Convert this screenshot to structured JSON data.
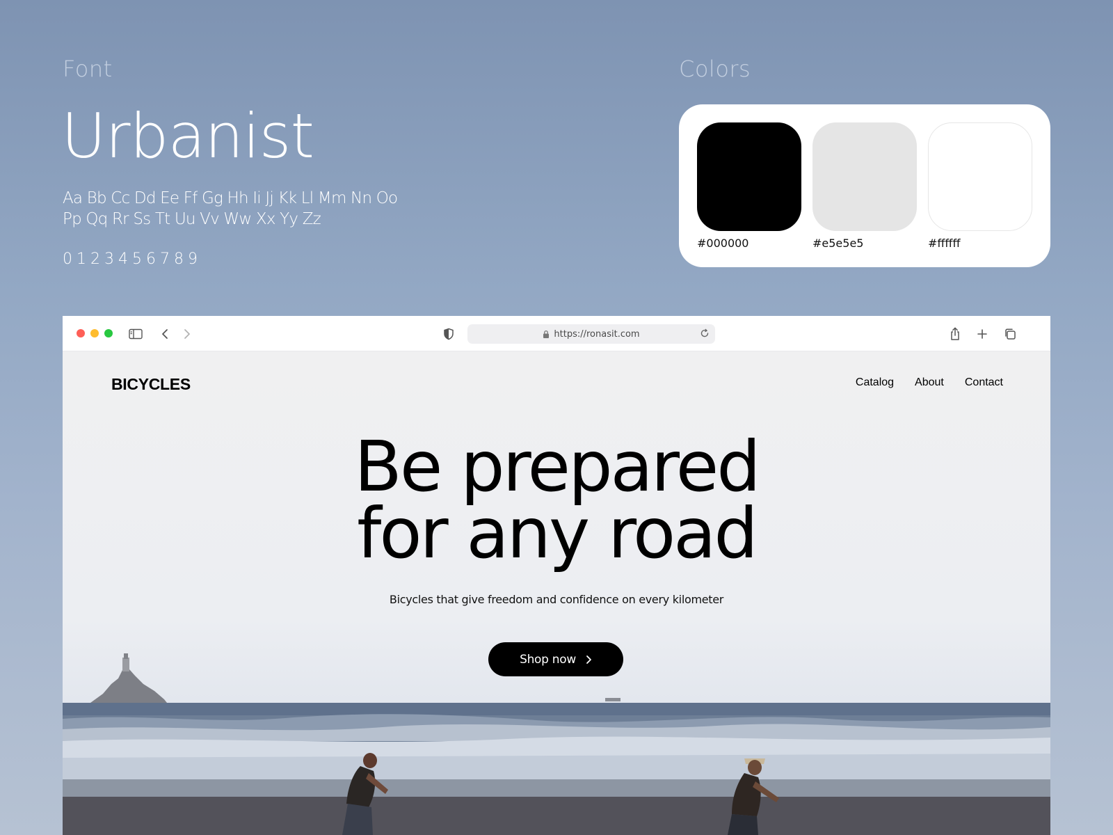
{
  "style_guide": {
    "font_label": "Font",
    "colors_label": "Colors",
    "font_name": "Urbanist",
    "alphabet_line1": "Aa Bb Cc Dd Ee Ff Gg Hh Ii Jj Kk Ll Mm Nn Oo",
    "alphabet_line2": "Pp Qq Rr Ss Tt Uu Vv Ww Xx Yy Zz",
    "digits": "0123456789",
    "swatches": [
      {
        "code": "#000000",
        "color": "#000000"
      },
      {
        "code": "#e5e5e5",
        "color": "#e5e5e5"
      },
      {
        "code": "#ffffff",
        "color": "#ffffff"
      }
    ]
  },
  "browser": {
    "url": "https://ronasit.com"
  },
  "site": {
    "brand": "BICYCLES",
    "nav": [
      "Catalog",
      "About",
      "Contact"
    ],
    "headline_line1": "Be prepared",
    "headline_line2": "for any road",
    "subtitle": "Bicycles that give freedom and confidence on every kilometer",
    "cta_label": "Shop now"
  }
}
